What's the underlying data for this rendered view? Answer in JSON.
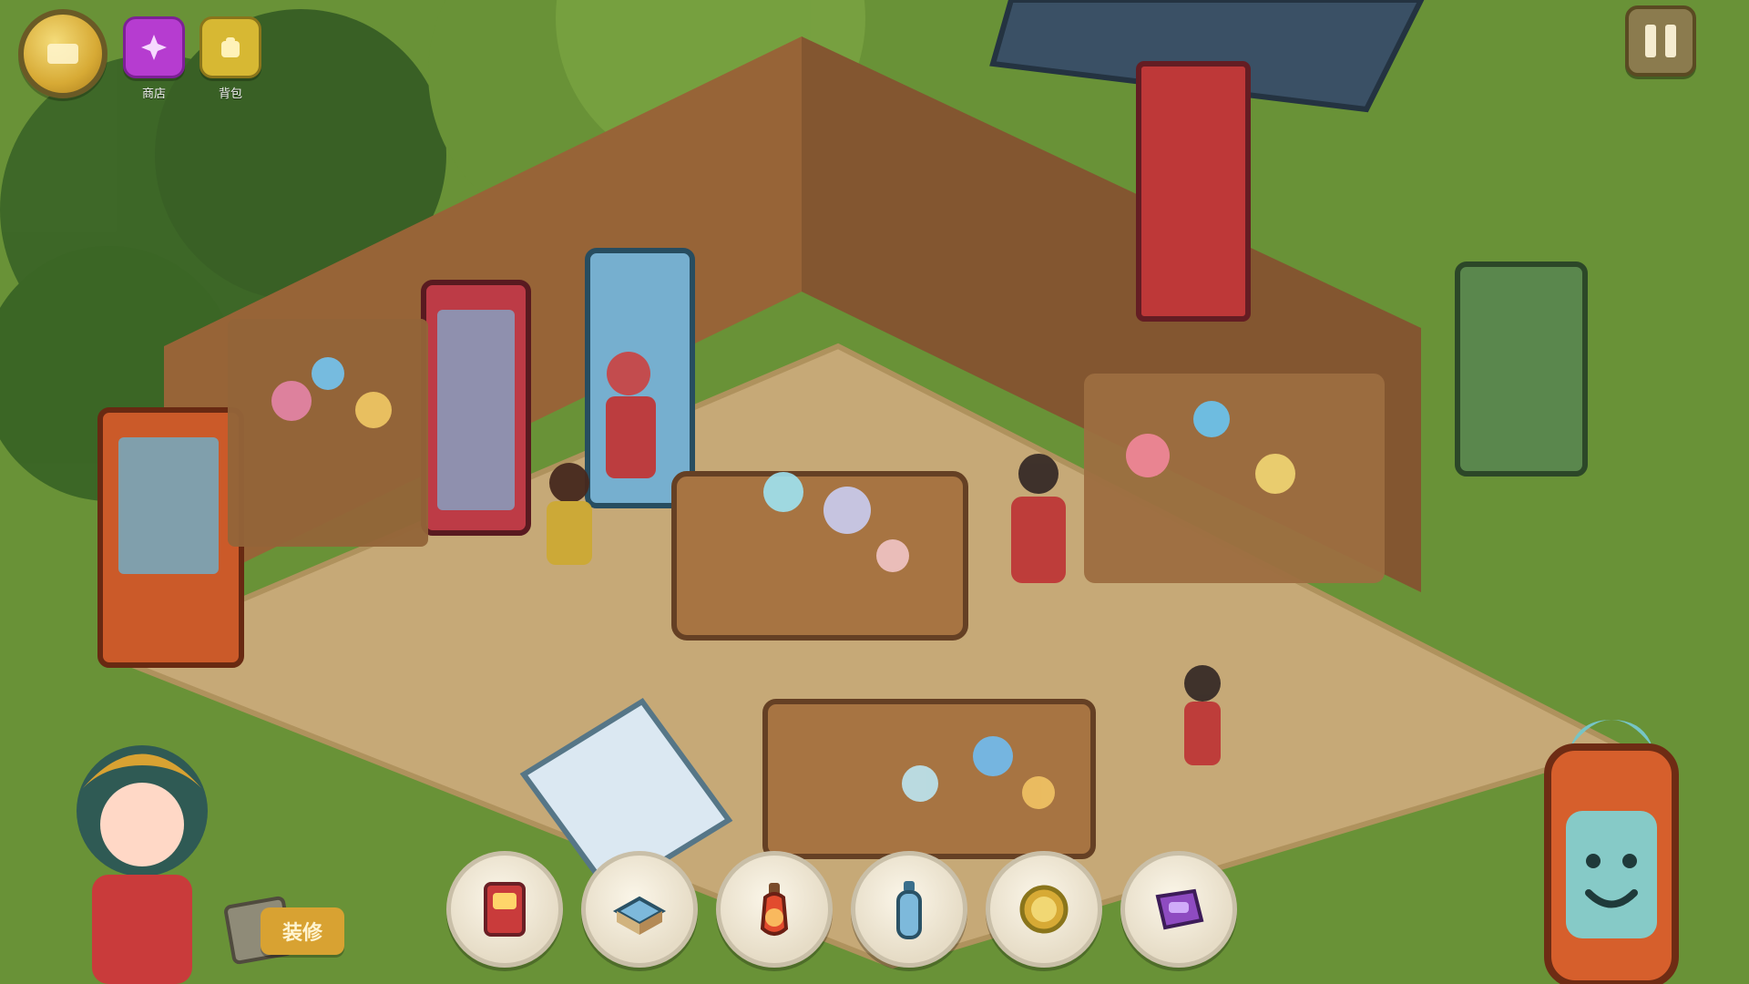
{
  "hud": {
    "top_left": {
      "coin": {
        "icon": "coin-icon"
      },
      "chips": [
        {
          "icon": "magic-icon",
          "label": "商店"
        },
        {
          "icon": "bag-icon",
          "label": "背包"
        }
      ]
    },
    "pause": {
      "icon": "pause-icon"
    }
  },
  "bottom": {
    "left_action_label": "装修",
    "dock_items": [
      {
        "icon": "card-pack-icon"
      },
      {
        "icon": "cooler-box-icon"
      },
      {
        "icon": "potion-bottle-icon"
      },
      {
        "icon": "water-bottle-icon"
      },
      {
        "icon": "gold-coin-icon"
      },
      {
        "icon": "purple-ticket-icon"
      }
    ]
  },
  "colors": {
    "grass": "#6f9a3a",
    "wood": "#a06a3a",
    "floor": "#d1b37e",
    "accent_red": "#c93b3b",
    "accent_gold": "#d8a232"
  }
}
